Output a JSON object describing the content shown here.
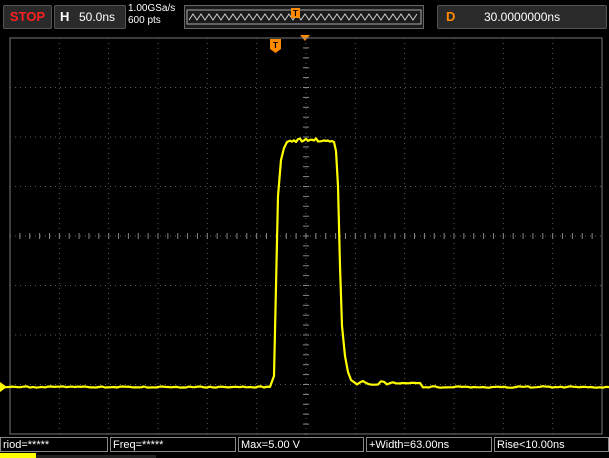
{
  "toolbar": {
    "run_state": "STOP",
    "horizontal_label": "H",
    "timebase": "50.0ns",
    "sample_rate": "1.00GSa/s",
    "memory_depth": "600 pts",
    "delay_label": "D",
    "delay_value": "30.0000000ns"
  },
  "trigger": {
    "marker_letter": "T"
  },
  "colors": {
    "channel1": "#ffff00",
    "trigger": "#ff8a00",
    "stop": "#ff2020",
    "grid": "#5a5a5a"
  },
  "measurements": [
    {
      "label": "riod=*****"
    },
    {
      "label": "Freq=*****"
    },
    {
      "label": "Max=5.00 V"
    },
    {
      "label": "+Width=63.00ns"
    },
    {
      "label": "Rise<10.00ns"
    }
  ]
}
